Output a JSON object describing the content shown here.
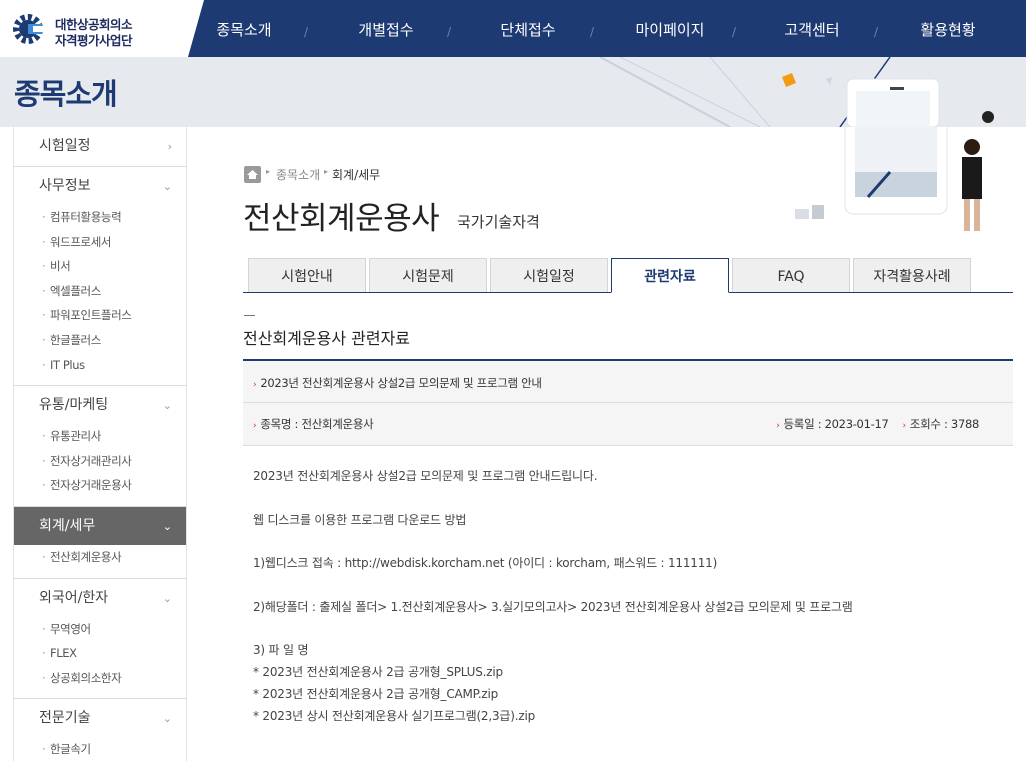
{
  "logo": {
    "line1": "대한상공회의소",
    "line2": "자격평가사업단"
  },
  "nav": [
    "종목소개",
    "개별접수",
    "단체접수",
    "마이페이지",
    "고객센터",
    "활용현황"
  ],
  "banner": {
    "title": "종목소개"
  },
  "sidebar": {
    "groups": [
      {
        "label": "시험일정",
        "chev": "›",
        "items": []
      },
      {
        "label": "사무정보",
        "chev": "⌄",
        "items": [
          "컴퓨터활용능력",
          "워드프로세서",
          "비서",
          "엑셀플러스",
          "파워포인트플러스",
          "한글플러스",
          "IT Plus"
        ]
      },
      {
        "label": "유통/마케팅",
        "chev": "⌄",
        "items": [
          "유통관리사",
          "전자상거래관리사",
          "전자상거래운용사"
        ]
      },
      {
        "label": "회계/세무",
        "chev": "⌄",
        "items": [
          "전산회계운용사"
        ]
      },
      {
        "label": "외국어/한자",
        "chev": "⌄",
        "items": [
          "무역영어",
          "FLEX",
          "상공회의소한자"
        ]
      },
      {
        "label": "전문기술",
        "chev": "⌄",
        "items": [
          "한글속기"
        ]
      }
    ]
  },
  "breadcrumb": {
    "level1": "종목소개",
    "level2": "회계/세무"
  },
  "page": {
    "title": "전산회계운용사",
    "subtitle": "국가기술자격"
  },
  "tabs": [
    "시험안내",
    "시험문제",
    "시험일정",
    "관련자료",
    "FAQ",
    "자격활용사례"
  ],
  "active_tab": "관련자료",
  "section": {
    "title": "전산회계운용사 관련자료"
  },
  "post": {
    "title": "2023년 전산회계운용사 상설2급 모의문제 및 프로그램 안내",
    "subject_label": "종목명 : 전산회계운용사",
    "date_label": "등록일 : 2023-01-17",
    "views_label": "조회수 : 3788",
    "body": {
      "intro": "2023년 전산회계운용사 상설2급 모의문제 및 프로그램 안내드립니다.",
      "method": "웹 디스크를 이용한 프로그램 다운로드 방법",
      "step1": "1)웹디스크 접속 :   http://webdisk.korcham.net (아이디 : korcham, 패스워드 : 111111)",
      "step2": "2)해당폴더 : 출제실 폴더> 1.전산회계운용사> 3.실기모의고사> 2023년 전산회계운용사 상설2급 모의문제 및 프로그램",
      "step3": "3) 파 일 명",
      "file1": "* 2023년 전산회계운용사 2급 공개형_SPLUS.zip",
      "file2": "* 2023년 전산회계운용사 2급 공개형_CAMP.zip",
      "file3": "* 2023년 상시 전산회계운용사 실기프로그램(2,3급).zip"
    }
  },
  "colors": {
    "navy": "#1d3a73",
    "sidebar_active": "#666666",
    "accent_red": "#c0392b"
  }
}
